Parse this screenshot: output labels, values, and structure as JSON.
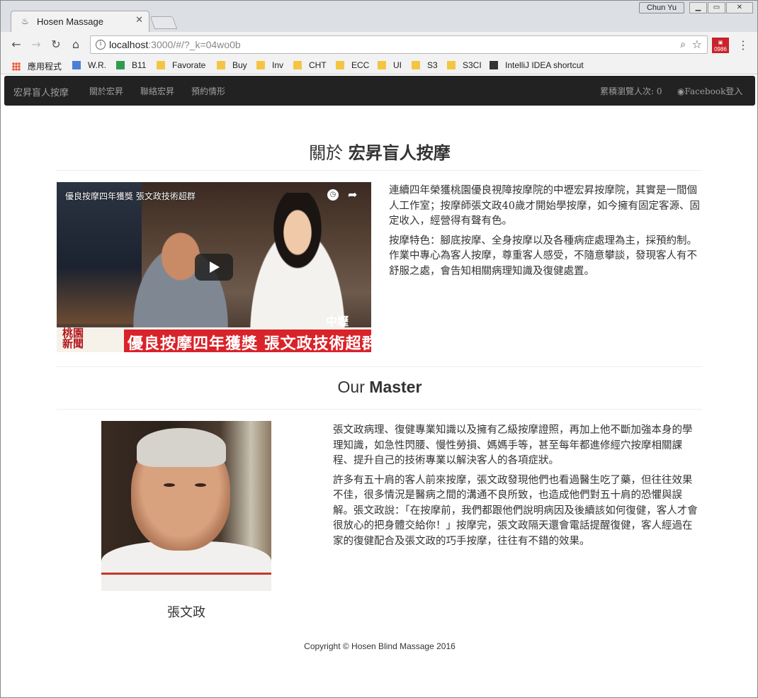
{
  "browser": {
    "tab_title": "Hosen Massage",
    "user_name": "Chun Yu",
    "url_host": "localhost",
    "url_path": ":3000/#/?_k=04wo0b",
    "ext_badge": "0986",
    "bookmarks": [
      {
        "label": "應用程式",
        "icon": "apps-icon"
      },
      {
        "label": "W.R.",
        "icon": "docs-icon"
      },
      {
        "label": "B11",
        "icon": "sheets-icon"
      },
      {
        "label": "Favorate",
        "icon": "folder-icon"
      },
      {
        "label": "Buy",
        "icon": "folder-icon"
      },
      {
        "label": "Inv",
        "icon": "folder-icon"
      },
      {
        "label": "CHT",
        "icon": "folder-icon"
      },
      {
        "label": "ECC",
        "icon": "folder-icon"
      },
      {
        "label": "UI",
        "icon": "folder-icon"
      },
      {
        "label": "S3",
        "icon": "folder-icon"
      },
      {
        "label": "S3CI",
        "icon": "folder-icon"
      },
      {
        "label": "IntelliJ IDEA shortcut",
        "icon": "intellij-icon"
      }
    ]
  },
  "navbar": {
    "brand": "宏昇盲人按摩",
    "links": [
      "關於宏昇",
      "聯絡宏昇",
      "預約情形"
    ],
    "visitor_count": "累積瀏覽人次: 0",
    "facebook_login": "Facebook登入"
  },
  "about": {
    "title_prefix": "關於 ",
    "title_bold": "宏昇盲人按摩",
    "video": {
      "title": "優良按摩四年獲獎 張文政技術超群",
      "caption": "優良按摩四年獲獎  張文政技術超群",
      "station": "桃園\n新聞",
      "logo": "中壢"
    },
    "paragraphs": [
      "連續四年榮獲桃園優良視障按摩院的中壢宏昇按摩院，其實是一間個人工作室；按摩師張文政40歲才開始學按摩，如今擁有固定客源、固定收入，經營得有聲有色。",
      "按摩特色：腳底按摩、全身按摩以及各種病症處理為主，採預約制。作業中專心為客人按摩，尊重客人感受，不隨意攀談，發現客人有不舒服之處，會告知相關病理知識及復健處置。"
    ]
  },
  "master": {
    "title_prefix": "Our ",
    "title_bold": "Master",
    "name": "張文政",
    "paragraphs": [
      "張文政病理、復健專業知識以及擁有乙級按摩證照，再加上他不斷加強本身的學理知識，如急性閃腰、慢性勞損、媽媽手等，甚至每年都進修經穴按摩相關課程、提升自己的技術專業以解決客人的各項症狀。",
      "許多有五十肩的客人前來按摩，張文政發現他們也看過醫生吃了藥，但往往效果不佳，很多情況是醫病之間的溝通不良所致，也造成他們對五十肩的恐懼與誤解。張文政說：「在按摩前，我們都跟他們說明病因及後續該如何復健，客人才會很放心的把身體交給你！」按摩完，張文政隔天還會電話提醒復健，客人經過在家的復健配合及張文政的巧手按摩，往往有不錯的效果。"
    ]
  },
  "footer": {
    "copyright": "Copyright © Hosen Blind Massage 2016"
  }
}
